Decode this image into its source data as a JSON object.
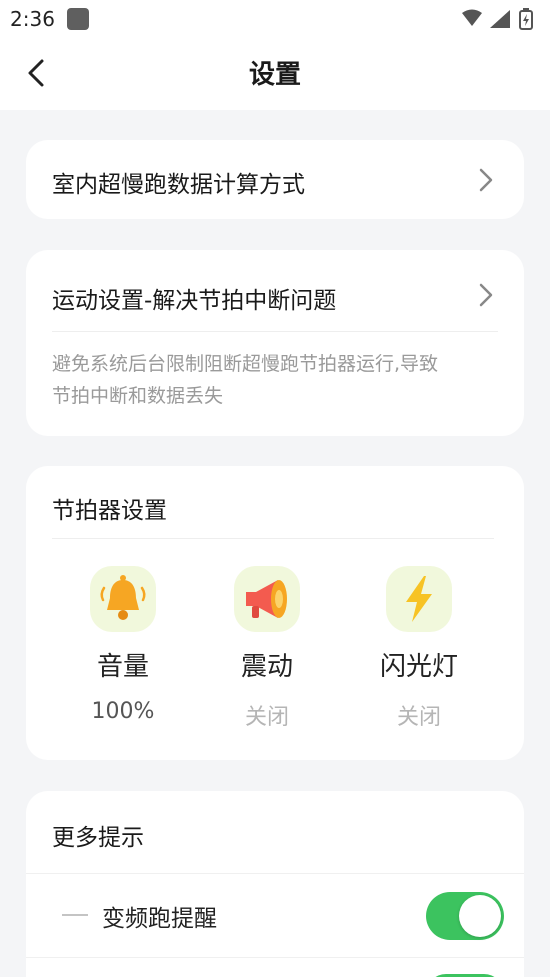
{
  "status_bar": {
    "time": "2:36"
  },
  "header": {
    "title": "设置"
  },
  "settings": {
    "indoor_row": {
      "label": "室内超慢跑数据计算方式"
    },
    "sport_settings": {
      "label": "运动设置-解决节拍中断问题",
      "description_line1": "避免系统后台限制阻断超慢跑节拍器运行,导致",
      "description_line2": "节拍中断和数据丢失"
    },
    "metronome": {
      "title": "节拍器设置",
      "items": [
        {
          "label": "音量",
          "value": "100%",
          "icon": "bell-icon"
        },
        {
          "label": "震动",
          "value": "关闭",
          "icon": "megaphone-icon"
        },
        {
          "label": "闪光灯",
          "value": "关闭",
          "icon": "lightning-icon"
        }
      ]
    },
    "more_tips": {
      "title": "更多提示",
      "rows": [
        {
          "label": "变频跑提醒",
          "enabled": true
        }
      ]
    }
  },
  "colors": {
    "accent_green": "#3cc35f",
    "value_dark": "#555555",
    "value_muted": "#b5b5b5"
  }
}
